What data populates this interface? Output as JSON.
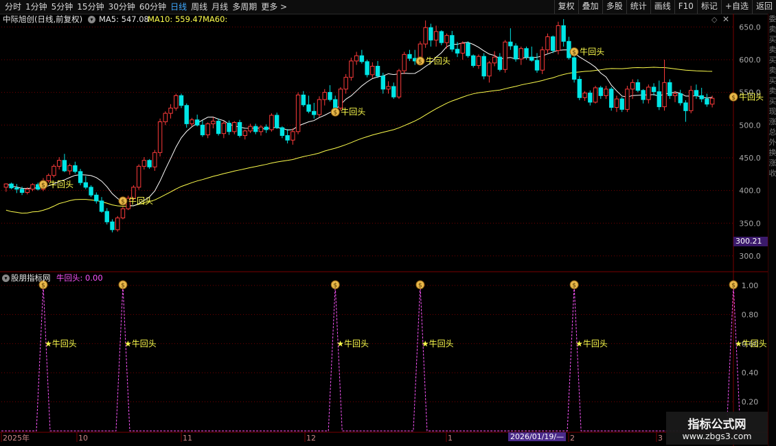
{
  "toolbar": {
    "periods": [
      "分时",
      "1分钟",
      "5分钟",
      "15分钟",
      "30分钟",
      "60分钟",
      "日线",
      "周线",
      "月线",
      "多周期",
      "更多 >"
    ],
    "active_index": 6,
    "right_buttons": [
      "复权",
      "叠加",
      "多股",
      "统计",
      "画线",
      "F10",
      "标记",
      "+自选",
      "返回"
    ]
  },
  "title": {
    "stock_name": "中际旭创(日线,前复权)",
    "ma5": "MA5: 547.08",
    "ma10": "MA10: 559.47",
    "ma60": "MA60:"
  },
  "indicator": {
    "name": "股朋指标网",
    "value": "牛回头: 0.00",
    "signal_label": "★牛回头"
  },
  "price_axis": {
    "labels": [
      "650.0",
      "600.0",
      "550.0",
      "500.0",
      "450.0",
      "400.0",
      "350.0",
      "300.0"
    ],
    "current_price": "300.21"
  },
  "indicator_axis": {
    "labels": [
      "1.00",
      "0.80",
      "0.60",
      "0.40",
      "0.20"
    ]
  },
  "date_axis": {
    "labels": [
      "2025年",
      "10",
      "11",
      "12",
      "1",
      "2",
      "3"
    ],
    "cursor_date": "2026/01/19/—"
  },
  "signals": {
    "price_label": "牛回头",
    "price_signal_prices": [
      409,
      384,
      520,
      598,
      612,
      543
    ]
  },
  "watermark": {
    "title": "指标公式网",
    "url": "www.zbgs3.com"
  },
  "right_panel_text": "委卖买卖买卖买卖买现涨总外换涨收",
  "colors": {
    "up": "#ff3b3b",
    "down": "#00e5e5",
    "ma5": "#ffffff",
    "ma60": "#ffff4d",
    "indicator": "#ff55ff",
    "grid": "#7a0000",
    "label": "#ffff4d"
  },
  "chart_data": {
    "type": "candlestick",
    "y_range": [
      280,
      665
    ],
    "candles": [
      [
        405,
        411,
        398,
        410
      ],
      [
        410,
        412,
        402,
        404
      ],
      [
        404,
        410,
        396,
        402
      ],
      [
        402,
        406,
        393,
        397
      ],
      [
        397,
        405,
        394,
        402
      ],
      [
        402,
        411,
        399,
        409
      ],
      [
        409,
        412,
        400,
        402
      ],
      [
        402,
        419,
        399,
        415
      ],
      [
        415,
        426,
        412,
        423
      ],
      [
        423,
        440,
        420,
        437
      ],
      [
        437,
        451,
        432,
        446
      ],
      [
        446,
        456,
        428,
        430
      ],
      [
        430,
        441,
        424,
        438
      ],
      [
        438,
        444,
        426,
        429
      ],
      [
        429,
        433,
        408,
        412
      ],
      [
        412,
        422,
        402,
        405
      ],
      [
        405,
        408,
        390,
        393
      ],
      [
        393,
        397,
        380,
        384
      ],
      [
        384,
        390,
        366,
        368
      ],
      [
        368,
        373,
        348,
        352
      ],
      [
        352,
        356,
        336,
        340
      ],
      [
        340,
        361,
        337,
        358
      ],
      [
        358,
        375,
        356,
        372
      ],
      [
        372,
        392,
        370,
        388
      ],
      [
        388,
        408,
        385,
        405
      ],
      [
        405,
        440,
        401,
        437
      ],
      [
        437,
        451,
        432,
        446
      ],
      [
        446,
        448,
        433,
        436
      ],
      [
        436,
        462,
        430,
        458
      ],
      [
        458,
        510,
        452,
        505
      ],
      [
        505,
        521,
        500,
        518
      ],
      [
        518,
        532,
        510,
        526
      ],
      [
        526,
        548,
        522,
        545
      ],
      [
        545,
        548,
        526,
        530
      ],
      [
        530,
        533,
        496,
        502
      ],
      [
        502,
        511,
        498,
        508
      ],
      [
        508,
        516,
        498,
        500
      ],
      [
        500,
        507,
        482,
        485
      ],
      [
        485,
        504,
        480,
        502
      ],
      [
        502,
        512,
        495,
        506
      ],
      [
        506,
        510,
        484,
        487
      ],
      [
        487,
        506,
        480,
        503
      ],
      [
        503,
        507,
        485,
        490
      ],
      [
        490,
        506,
        486,
        504
      ],
      [
        504,
        508,
        481,
        484
      ],
      [
        484,
        493,
        478,
        491
      ],
      [
        491,
        502,
        488,
        498
      ],
      [
        498,
        502,
        486,
        490
      ],
      [
        490,
        500,
        484,
        497
      ],
      [
        497,
        501,
        488,
        493
      ],
      [
        493,
        518,
        490,
        515
      ],
      [
        515,
        519,
        494,
        496
      ],
      [
        496,
        498,
        480,
        484
      ],
      [
        484,
        494,
        472,
        477
      ],
      [
        477,
        495,
        470,
        490
      ],
      [
        490,
        550,
        486,
        546
      ],
      [
        546,
        552,
        528,
        531
      ],
      [
        531,
        545,
        518,
        521
      ],
      [
        521,
        534,
        510,
        516
      ],
      [
        516,
        544,
        512,
        539
      ],
      [
        539,
        555,
        530,
        550
      ],
      [
        550,
        561,
        536,
        539
      ],
      [
        539,
        545,
        520,
        526
      ],
      [
        526,
        558,
        522,
        555
      ],
      [
        555,
        578,
        548,
        573
      ],
      [
        573,
        603,
        568,
        598
      ],
      [
        598,
        612,
        592,
        606
      ],
      [
        606,
        615,
        594,
        597
      ],
      [
        597,
        600,
        573,
        577
      ],
      [
        577,
        596,
        572,
        590
      ],
      [
        590,
        598,
        572,
        575
      ],
      [
        575,
        580,
        548,
        555
      ],
      [
        555,
        567,
        548,
        559
      ],
      [
        559,
        565,
        540,
        543
      ],
      [
        543,
        586,
        540,
        583
      ],
      [
        583,
        612,
        578,
        608
      ],
      [
        608,
        615,
        598,
        602
      ],
      [
        602,
        615,
        592,
        598
      ],
      [
        598,
        628,
        595,
        624
      ],
      [
        624,
        660,
        618,
        649
      ],
      [
        649,
        655,
        620,
        630
      ],
      [
        630,
        652,
        620,
        643
      ],
      [
        643,
        645,
        622,
        626
      ],
      [
        626,
        640,
        617,
        637
      ],
      [
        637,
        644,
        612,
        616
      ],
      [
        616,
        627,
        604,
        610
      ],
      [
        610,
        628,
        600,
        625
      ],
      [
        625,
        628,
        603,
        606
      ],
      [
        606,
        608,
        588,
        591
      ],
      [
        591,
        608,
        586,
        605
      ],
      [
        605,
        610,
        570,
        575
      ],
      [
        575,
        598,
        565,
        595
      ],
      [
        595,
        613,
        590,
        604
      ],
      [
        604,
        610,
        582,
        585
      ],
      [
        585,
        630,
        580,
        627
      ],
      [
        627,
        648,
        615,
        621
      ],
      [
        621,
        625,
        597,
        601
      ],
      [
        601,
        620,
        592,
        617
      ],
      [
        617,
        620,
        600,
        604
      ],
      [
        604,
        620,
        597,
        599
      ],
      [
        599,
        610,
        580,
        584
      ],
      [
        584,
        620,
        578,
        615
      ],
      [
        615,
        640,
        610,
        635
      ],
      [
        635,
        637,
        610,
        614
      ],
      [
        614,
        658,
        608,
        652
      ],
      [
        652,
        662,
        620,
        628
      ],
      [
        628,
        635,
        600,
        603
      ],
      [
        603,
        608,
        565,
        570
      ],
      [
        570,
        575,
        538,
        542
      ],
      [
        542,
        552,
        537,
        549
      ],
      [
        549,
        553,
        530,
        535
      ],
      [
        535,
        560,
        533,
        557
      ],
      [
        557,
        560,
        540,
        545
      ],
      [
        545,
        560,
        540,
        555
      ],
      [
        555,
        558,
        522,
        527
      ],
      [
        527,
        545,
        520,
        540
      ],
      [
        540,
        543,
        520,
        524
      ],
      [
        524,
        560,
        520,
        555
      ],
      [
        555,
        570,
        540,
        565
      ],
      [
        565,
        570,
        550,
        553
      ],
      [
        553,
        555,
        533,
        539
      ],
      [
        539,
        562,
        533,
        558
      ],
      [
        558,
        564,
        545,
        551
      ],
      [
        551,
        568,
        523,
        528
      ],
      [
        528,
        600,
        522,
        565
      ],
      [
        565,
        570,
        540,
        545
      ],
      [
        545,
        552,
        535,
        548
      ],
      [
        548,
        554,
        530,
        534
      ],
      [
        534,
        538,
        505,
        522
      ],
      [
        522,
        560,
        518,
        553
      ],
      [
        553,
        562,
        540,
        545
      ],
      [
        545,
        557,
        535,
        540
      ],
      [
        540,
        548,
        528,
        532
      ],
      [
        532,
        545,
        527,
        541
      ]
    ],
    "ma5": [],
    "indicator_peaks_at_index": [
      7,
      22,
      62,
      78,
      107,
      137
    ]
  }
}
